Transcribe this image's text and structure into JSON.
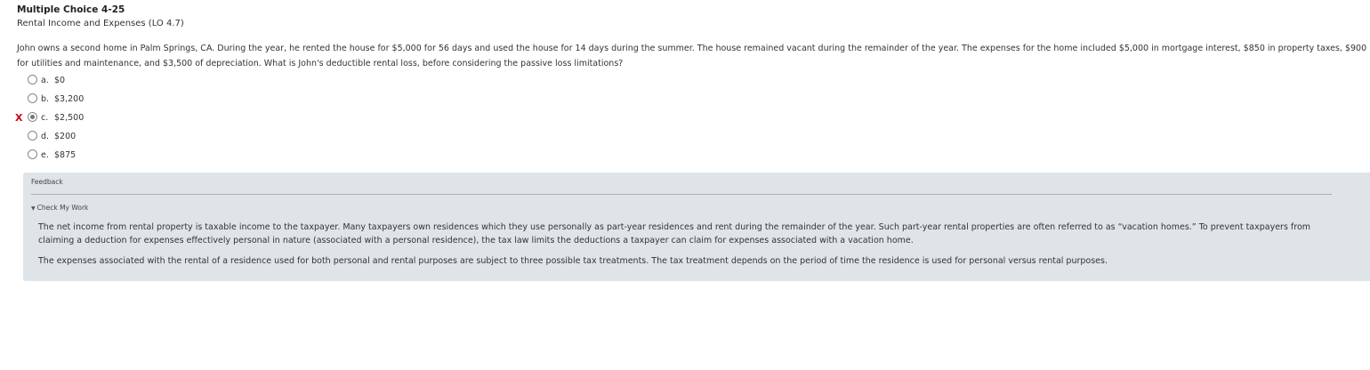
{
  "header": {
    "title": "Multiple Choice 4-25",
    "subtitle": "Rental Income and Expenses (LO 4.7)"
  },
  "question": {
    "text": "John owns a second home in Palm Springs, CA. During the year, he rented the house for $5,000 for 56 days and used the house for 14 days during the summer. The house remained vacant during the remainder of the year. The expenses for the home included $5,000 in mortgage interest, $850 in property taxes, $900 for utilities and maintenance, and $3,500 of depreciation. What is John's deductible rental loss, before considering the passive loss limitations?"
  },
  "options": [
    {
      "letter": "a.",
      "text": "$0",
      "selected": false,
      "incorrect_mark": ""
    },
    {
      "letter": "b.",
      "text": "$3,200",
      "selected": false,
      "incorrect_mark": ""
    },
    {
      "letter": "c.",
      "text": "$2,500",
      "selected": true,
      "incorrect_mark": "X"
    },
    {
      "letter": "d.",
      "text": "$200",
      "selected": false,
      "incorrect_mark": ""
    },
    {
      "letter": "e.",
      "text": "$875",
      "selected": false,
      "incorrect_mark": ""
    }
  ],
  "feedback": {
    "label": "Feedback",
    "toggle_label": "Check My Work",
    "toggle_icon": "triangle-down-icon",
    "paragraph1": "The net income from rental property is taxable income to the taxpayer. Many taxpayers own residences which they use personally as part-year residences and rent during the remainder of the year. Such part-year rental properties are often referred to as “vacation homes.” To prevent taxpayers from claiming a deduction for expenses effectively personal in nature (associated with a personal residence), the tax law limits the deductions a taxpayer can claim for expenses associated with a vacation home.",
    "paragraph2": "The expenses associated with the rental of a residence used for both personal and rental purposes are subject to three possible tax treatments. The tax treatment depends on the period of time the residence is used for personal versus rental purposes."
  },
  "colors": {
    "incorrect_mark": "#d0021b",
    "feedback_background": "#dfe4e8"
  }
}
